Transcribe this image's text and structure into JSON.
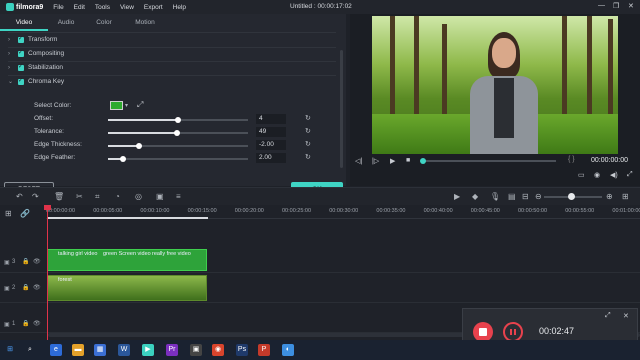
{
  "app": {
    "brand": "filmora9",
    "menu": [
      "File",
      "Edit",
      "Tools",
      "View",
      "Export",
      "Help"
    ],
    "title": "Untitled : 00:00:17:02"
  },
  "window_controls": {
    "minimize": "—",
    "restore": "❐",
    "close": "✕"
  },
  "tabs": [
    {
      "label": "Video"
    },
    {
      "label": "Audio"
    },
    {
      "label": "Color"
    },
    {
      "label": "Motion"
    }
  ],
  "sections": [
    {
      "label": "Transform",
      "expanded": false
    },
    {
      "label": "Compositing",
      "expanded": false
    },
    {
      "label": "Stabilization",
      "expanded": false
    },
    {
      "label": "Chroma Key",
      "expanded": true
    }
  ],
  "chroma": {
    "select_color_label": "Select Color:",
    "key_color": "#2eaa2e",
    "params": [
      {
        "label": "Offset:",
        "value": "4",
        "level": 0.5
      },
      {
        "label": "Tolerance:",
        "value": "49",
        "level": 0.49
      },
      {
        "label": "Edge Thickness:",
        "value": "-2.00",
        "level": 0.22
      },
      {
        "label": "Edge Feather:",
        "value": "2.00",
        "level": 0.11
      }
    ]
  },
  "buttons": {
    "reset": "RESET",
    "ok": "OK"
  },
  "preview": {
    "timecode": "00:00:00:00",
    "braces": "{  }"
  },
  "timeline": {
    "ticks": [
      "00:00:00:00",
      "00:00:05:00",
      "00:00:10:00",
      "00:00:15:00",
      "00:00:20:00",
      "00:00:25:00",
      "00:00:30:00",
      "00:00:35:00",
      "00:00:40:00",
      "00:00:45:00",
      "00:00:50:00",
      "00:00:55:00",
      "00:01:00:00"
    ],
    "tracks": [
      {
        "label": "3"
      },
      {
        "label": "2"
      },
      {
        "label": "1"
      }
    ],
    "green_clip_titles": [
      "talking girl video",
      "green Screen video",
      "really free video"
    ],
    "forest_clip_label": "forest"
  },
  "recorder": {
    "time": "00:02:47"
  },
  "colors": {
    "accent": "#3fd4c4",
    "record": "#e8424d",
    "playhead": "#e0334a"
  }
}
